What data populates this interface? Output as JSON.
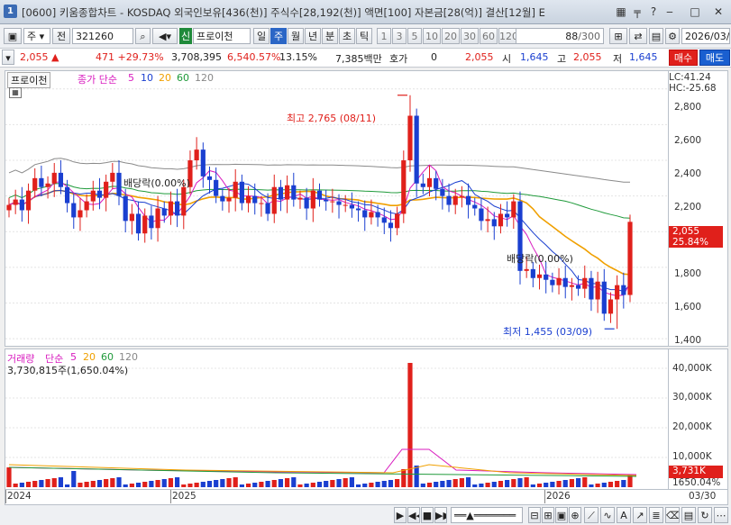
{
  "window": {
    "badge": "1",
    "title": "[0600] 키움종합차트 - KOSDAQ 외국인보유[436(천)] 주식수[28,192(천)] 액면[100] 자본금[28(억)] 결산[12월] E"
  },
  "toolbar": {
    "market": "주",
    "type_toggle": "전",
    "code": "321260",
    "new_badge": "신",
    "stock_name": "프로이천",
    "periods": [
      "일",
      "주",
      "월",
      "년",
      "분",
      "초",
      "틱"
    ],
    "selected_period": "주",
    "intervals": [
      "1",
      "3",
      "5",
      "10",
      "20",
      "30",
      "60",
      "120"
    ],
    "count": "88",
    "count_max": "/300",
    "date": "2026/03/3"
  },
  "quote": {
    "price": "2,055",
    "change": "471",
    "change_pct": "+29.73%",
    "volume": "3,708,395",
    "volume_pct": "6,540.57%",
    "turnover": "13.15%",
    "amount": "7,385백만",
    "bid_label": "호가",
    "bid_value": "0",
    "current": "2,055",
    "open_label": "시",
    "open": "1,645",
    "high_label": "고",
    "high": "2,055",
    "low_label": "저",
    "low": "1,645",
    "buy_button": "매수",
    "sell_button": "매도"
  },
  "price_panel": {
    "name": "프로이천",
    "ma_label": "종가 단순",
    "ma_periods": [
      "5",
      "10",
      "20",
      "60",
      "120"
    ],
    "lc": "LC:41.24",
    "hc": "HC:-25.68",
    "ticks": [
      "2,800",
      "2,600",
      "2,400",
      "2,200",
      "1,800",
      "1,600",
      "1,400"
    ],
    "current_price": "2,055",
    "current_pct": "25.84%",
    "high_annotation": "최고 2,765 (08/11)",
    "low_annotation": "최저 1,455 (03/09)",
    "dividend_label_1": "배당락(0.00%)",
    "dividend_label_2": "배당락(0.00%)"
  },
  "volume_panel": {
    "title": "거래량",
    "ma_label": "단순",
    "ma_periods": [
      "5",
      "20",
      "60",
      "120"
    ],
    "last_value": "3,730,815주(1,650.04%)",
    "ticks": [
      "40,000K",
      "30,000K",
      "20,000K",
      "10,000K"
    ],
    "current_volume": "3,731K",
    "current_pct": "1650.04%"
  },
  "date_axis": {
    "labels": [
      "2024",
      "2025",
      "2026"
    ],
    "right_label": "03/30"
  },
  "colors": {
    "up": "#e0201b",
    "down": "#1a3fd0",
    "ma5": "#d81bbf",
    "ma10": "#1a3fd0",
    "ma20": "#f0a000",
    "ma60": "#1f9a3a",
    "ma120": "#8a8a8a"
  },
  "chart_data": {
    "type": "candlestick",
    "title": "",
    "xlabel": "",
    "ylabel": "",
    "ylim": [
      1360,
      2900
    ],
    "weeks": 88,
    "price_range": {
      "high": 2765,
      "low": 1455,
      "last_close": 2055,
      "last_open": 1645
    },
    "close": [
      2150,
      2180,
      2120,
      2230,
      2300,
      2250,
      2270,
      2330,
      2250,
      2160,
      2080,
      2120,
      2170,
      2230,
      2190,
      2280,
      2330,
      2200,
      2060,
      2100,
      1990,
      2090,
      2020,
      2130,
      2090,
      2170,
      2090,
      2250,
      2400,
      2460,
      2310,
      2290,
      2200,
      2170,
      2190,
      2280,
      2160,
      2200,
      2160,
      2160,
      2100,
      2250,
      2180,
      2260,
      2180,
      2190,
      2130,
      2230,
      2180,
      2170,
      2170,
      2150,
      2150,
      2130,
      2120,
      2080,
      2110,
      2080,
      2050,
      2020,
      2100,
      2400,
      2650,
      2270,
      2250,
      2300,
      2240,
      2200,
      2150,
      2200,
      2200,
      2150,
      2130,
      2060,
      2070,
      2030,
      2100,
      2080,
      2170,
      1780,
      1790,
      1740,
      1760,
      1730,
      1700,
      1740,
      1690,
      1700,
      1680,
      1740,
      1620,
      1720,
      1540,
      1620,
      1700,
      1645,
      2055
    ]
  }
}
